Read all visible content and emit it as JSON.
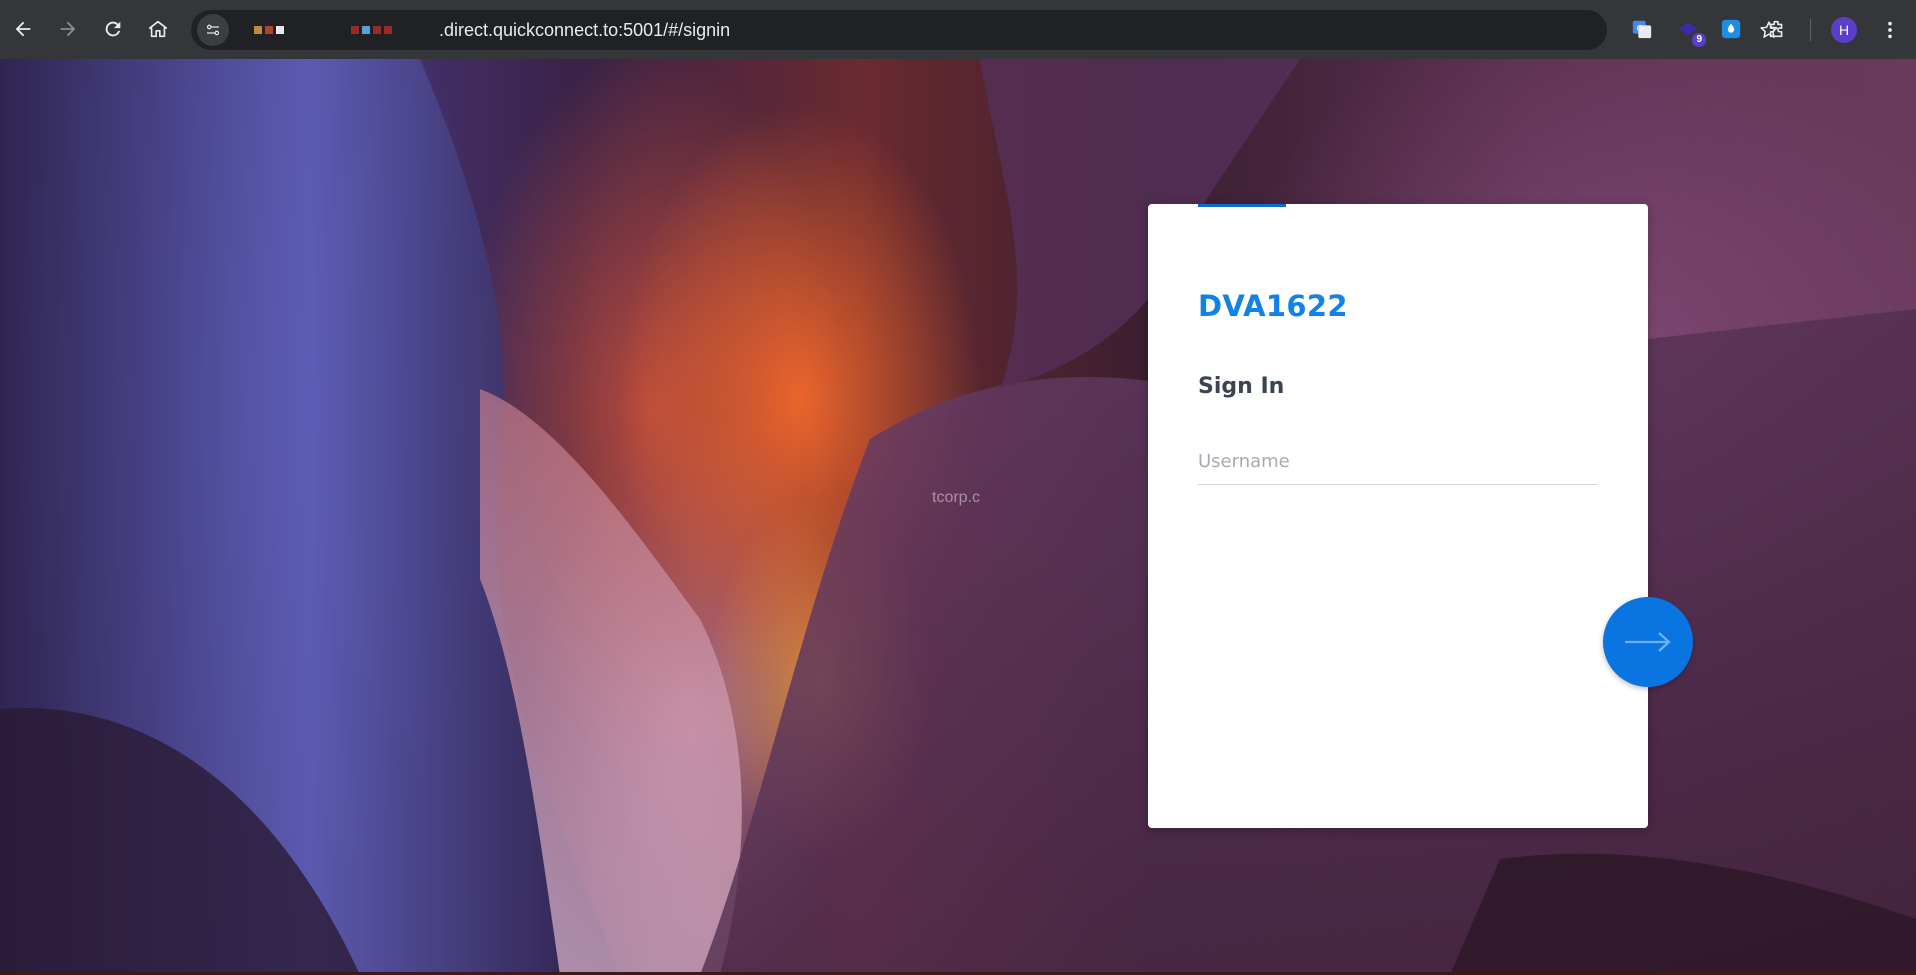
{
  "browser": {
    "url": ".direct.quickconnect.to:5001/#/signin",
    "extension_badge": "9",
    "profile_initial": "H",
    "icons": [
      "back-icon",
      "forward-icon",
      "reload-icon",
      "home-icon",
      "site-info-icon",
      "bookmark-star-icon",
      "google-translate-icon",
      "extension-icon",
      "dropper-icon",
      "puzzle-icon",
      "kebab-menu-icon"
    ]
  },
  "page": {
    "watermark": "tcorp.c",
    "background": "antelope canyon photo"
  },
  "login": {
    "device_name": "DVA1622",
    "title": "Sign In",
    "username_placeholder": "Username",
    "username_value": "",
    "next_icon": "arrow-right-icon",
    "accent_color": "#0a6ed1",
    "button_color": "#0a74e0"
  }
}
